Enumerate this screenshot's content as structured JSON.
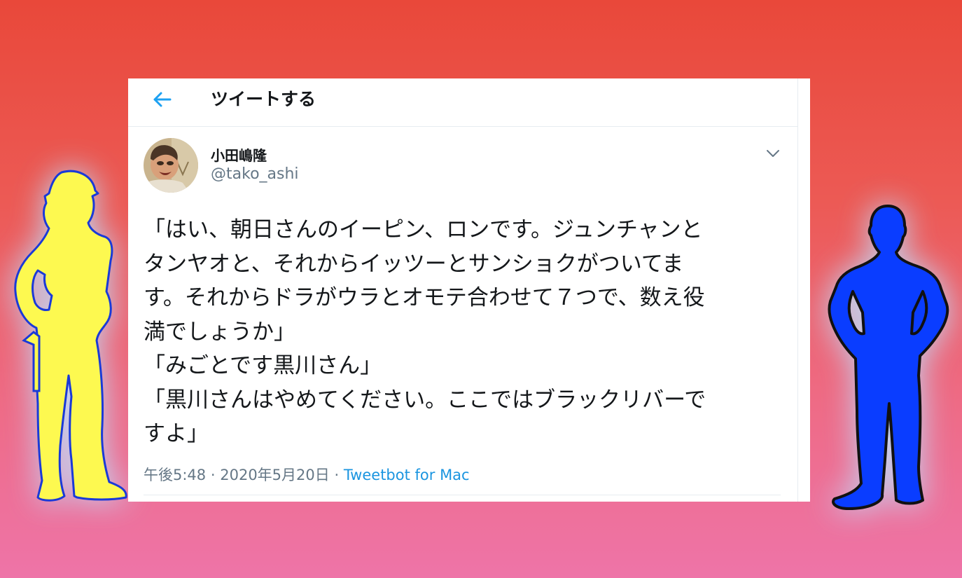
{
  "header": {
    "title": "ツイートする",
    "back_icon": "arrow-left-icon",
    "accent_color": "#1da1f2"
  },
  "tweet": {
    "author_name": "小田嶋隆",
    "author_handle": "@tako_ashi",
    "menu_icon": "chevron-down-icon",
    "lines": [
      "「はい、朝日さんのイーピン、ロンです。ジュンチャンと",
      "タンヤオと、それからイッツーとサンショクがついてま",
      "す。それからドラがウラとオモテ合わせて７つで、数え役",
      "満でしょうか」",
      "「みごとです黒川さん」",
      "「黒川さんはやめてください。ここではブラックリバーで",
      "すよ」"
    ],
    "time": "午後5:48",
    "separator1": "·",
    "date": "2020年5月20日",
    "separator2": "·",
    "source": "Tweetbot for Mac"
  },
  "decorations": {
    "left_figure": "worker-silhouette-yellow",
    "right_figure": "man-silhouette-blue",
    "left_fill": "#fdf950",
    "right_fill": "#0a3dff"
  }
}
